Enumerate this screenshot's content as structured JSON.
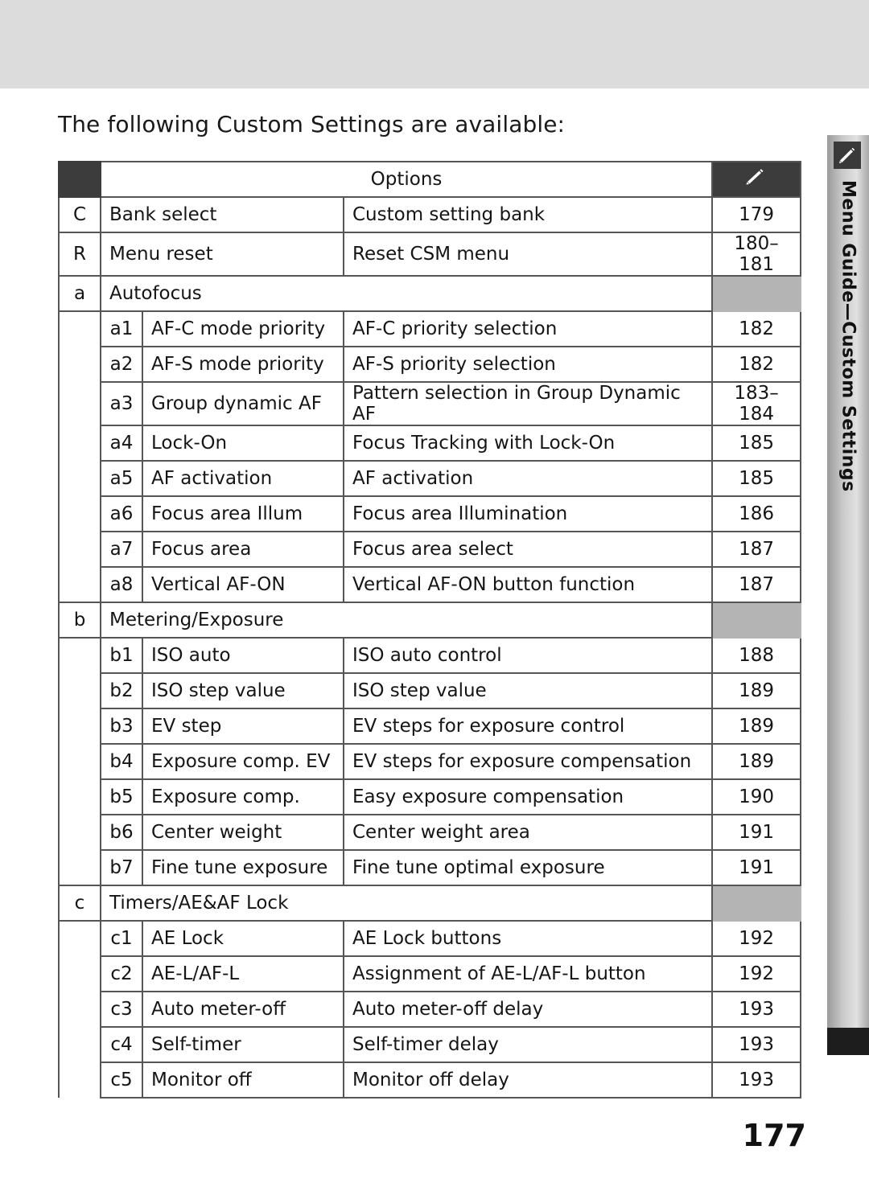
{
  "intro_text": "The following Custom Settings are available:",
  "side_tab": {
    "label": "Menu Guide—Custom Settings",
    "icon": "pencil-icon"
  },
  "page_number": "177",
  "table": {
    "header": {
      "options_label": "Options",
      "pencil_icon": "pencil-icon"
    },
    "rows": [
      {
        "type": "item",
        "code": "C",
        "sub": "",
        "name": "Bank select",
        "desc": "Custom setting bank",
        "page": "179",
        "shaded": true
      },
      {
        "type": "item",
        "code": "R",
        "sub": "",
        "name": "Menu reset",
        "desc": "Reset CSM menu",
        "page": "180–181",
        "shaded": true
      },
      {
        "type": "group",
        "code": "a",
        "name": "Autofocus"
      },
      {
        "type": "item",
        "code": "",
        "sub": "a1",
        "name": "AF-C mode priority",
        "desc": "AF-C priority selection",
        "page": "182",
        "shaded": false
      },
      {
        "type": "item",
        "code": "",
        "sub": "a2",
        "name": "AF-S mode priority",
        "desc": "AF-S priority selection",
        "page": "182",
        "shaded": false
      },
      {
        "type": "item",
        "code": "",
        "sub": "a3",
        "name": "Group dynamic AF",
        "desc": "Pattern selection in Group Dynamic AF",
        "page": "183–184",
        "shaded": false
      },
      {
        "type": "item",
        "code": "",
        "sub": "a4",
        "name": "Lock-On",
        "desc": "Focus Tracking with Lock-On",
        "page": "185",
        "shaded": false
      },
      {
        "type": "item",
        "code": "",
        "sub": "a5",
        "name": "AF activation",
        "desc": "AF activation",
        "page": "185",
        "shaded": false
      },
      {
        "type": "item",
        "code": "",
        "sub": "a6",
        "name": "Focus area Illum",
        "desc": "Focus area Illumination",
        "page": "186",
        "shaded": false
      },
      {
        "type": "item",
        "code": "",
        "sub": "a7",
        "name": "Focus area",
        "desc": "Focus area select",
        "page": "187",
        "shaded": false
      },
      {
        "type": "item",
        "code": "",
        "sub": "a8",
        "name": "Vertical AF-ON",
        "desc": "Vertical AF-ON button function",
        "page": "187",
        "shaded": false
      },
      {
        "type": "group",
        "code": "b",
        "name": "Metering/Exposure"
      },
      {
        "type": "item",
        "code": "",
        "sub": "b1",
        "name": "ISO auto",
        "desc": "ISO auto control",
        "page": "188",
        "shaded": false
      },
      {
        "type": "item",
        "code": "",
        "sub": "b2",
        "name": "ISO step value",
        "desc": "ISO step value",
        "page": "189",
        "shaded": false
      },
      {
        "type": "item",
        "code": "",
        "sub": "b3",
        "name": "EV step",
        "desc": "EV steps for exposure control",
        "page": "189",
        "shaded": false
      },
      {
        "type": "item",
        "code": "",
        "sub": "b4",
        "name": "Exposure comp. EV",
        "desc": "EV steps for exposure compensation",
        "page": "189",
        "shaded": false
      },
      {
        "type": "item",
        "code": "",
        "sub": "b5",
        "name": "Exposure comp.",
        "desc": "Easy exposure compensation",
        "page": "190",
        "shaded": false
      },
      {
        "type": "item",
        "code": "",
        "sub": "b6",
        "name": "Center weight",
        "desc": "Center weight area",
        "page": "191",
        "shaded": false
      },
      {
        "type": "item",
        "code": "",
        "sub": "b7",
        "name": "Fine tune exposure",
        "desc": "Fine tune optimal exposure",
        "page": "191",
        "shaded": false
      },
      {
        "type": "group",
        "code": "c",
        "name": "Timers/AE&AF Lock"
      },
      {
        "type": "item",
        "code": "",
        "sub": "c1",
        "name": "AE Lock",
        "desc": "AE Lock buttons",
        "page": "192",
        "shaded": false
      },
      {
        "type": "item",
        "code": "",
        "sub": "c2",
        "name": "AE-L/AF-L",
        "desc": "Assignment of AE-L/AF-L button",
        "page": "192",
        "shaded": false
      },
      {
        "type": "item",
        "code": "",
        "sub": "c3",
        "name": "Auto meter-off",
        "desc": "Auto meter-off delay",
        "page": "193",
        "shaded": false
      },
      {
        "type": "item",
        "code": "",
        "sub": "c4",
        "name": "Self-timer",
        "desc": "Self-timer delay",
        "page": "193",
        "shaded": false
      },
      {
        "type": "item",
        "code": "",
        "sub": "c5",
        "name": "Monitor off",
        "desc": "Monitor off delay",
        "page": "193",
        "shaded": false
      }
    ]
  }
}
